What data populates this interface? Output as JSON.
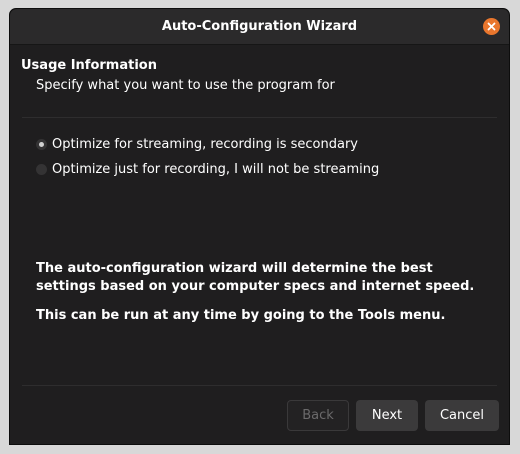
{
  "window": {
    "title": "Auto-Configuration Wizard",
    "close_icon": "close-icon"
  },
  "section": {
    "heading": "Usage Information",
    "subheading": "Specify what you want to use the program for"
  },
  "options": [
    {
      "label": "Optimize for streaming, recording is secondary",
      "selected": true
    },
    {
      "label": "Optimize just for recording, I will not be streaming",
      "selected": false
    }
  ],
  "info": {
    "line1": "The auto-configuration wizard will determine the best settings based on your computer specs and internet speed.",
    "line2": "This can be run at any time by going to the Tools menu."
  },
  "buttons": {
    "back": "Back",
    "next": "Next",
    "cancel": "Cancel"
  },
  "colors": {
    "accent_close": "#e9762d",
    "background": "#1f1e1f",
    "titlebar": "#2b2a2b",
    "button": "#3b3a3b"
  }
}
